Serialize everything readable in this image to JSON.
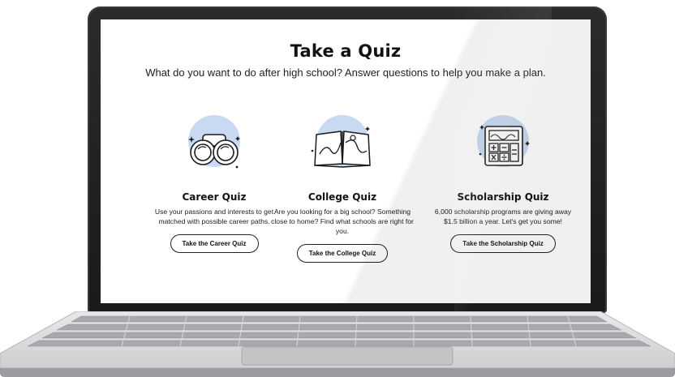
{
  "page": {
    "title": "Take a Quiz",
    "subtitle": "What do you want to do after high school? Answer questions to help you make a plan."
  },
  "quizzes": [
    {
      "title": "Career Quiz",
      "description": "Use your passions and interests to get matched with possible career paths.",
      "button": "Take the Career Quiz",
      "icon": "binoculars-icon"
    },
    {
      "title": "College Quiz",
      "description": "Are you looking for a big school? Something close to home? Find what schools are right for you.",
      "button": "Take the College Quiz",
      "icon": "open-book-map-icon"
    },
    {
      "title": "Scholarship Quiz",
      "description": "6,000 scholarship programs are giving away $1.5 billion a year. Let's get you some!",
      "button": "Take the Scholarship Quiz",
      "icon": "calculator-icon"
    }
  ],
  "colors": {
    "accent_circle": "#c9d9f2",
    "text": "#111111",
    "laptop_bezel": "#1a1a1c"
  }
}
